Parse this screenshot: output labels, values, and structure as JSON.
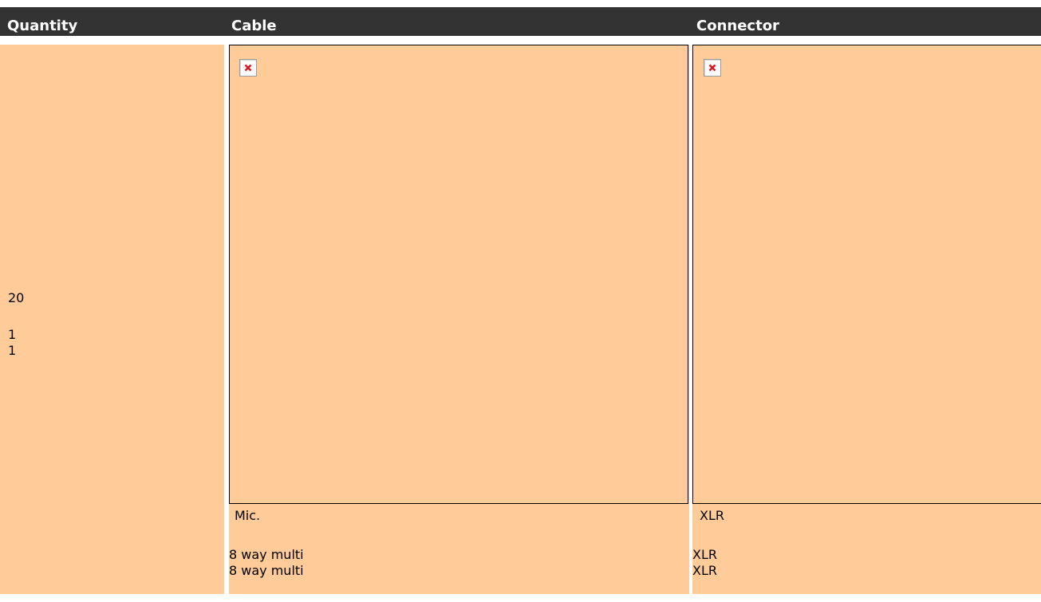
{
  "table": {
    "headers": [
      "Quantity",
      "Cable",
      "Connector"
    ],
    "quantities": [
      "20",
      "1",
      "1"
    ],
    "cables": [
      "Mic.",
      "8 way multi",
      "8 way multi"
    ],
    "connectors": [
      "XLR",
      "XLR",
      "XLR"
    ]
  },
  "colors": {
    "header_bg": "#333333",
    "header_text": "#ffffff",
    "cell_bg": "#ffcc99"
  },
  "icons": {
    "cable_image": "broken-image-icon",
    "connector_image": "broken-image-icon"
  }
}
